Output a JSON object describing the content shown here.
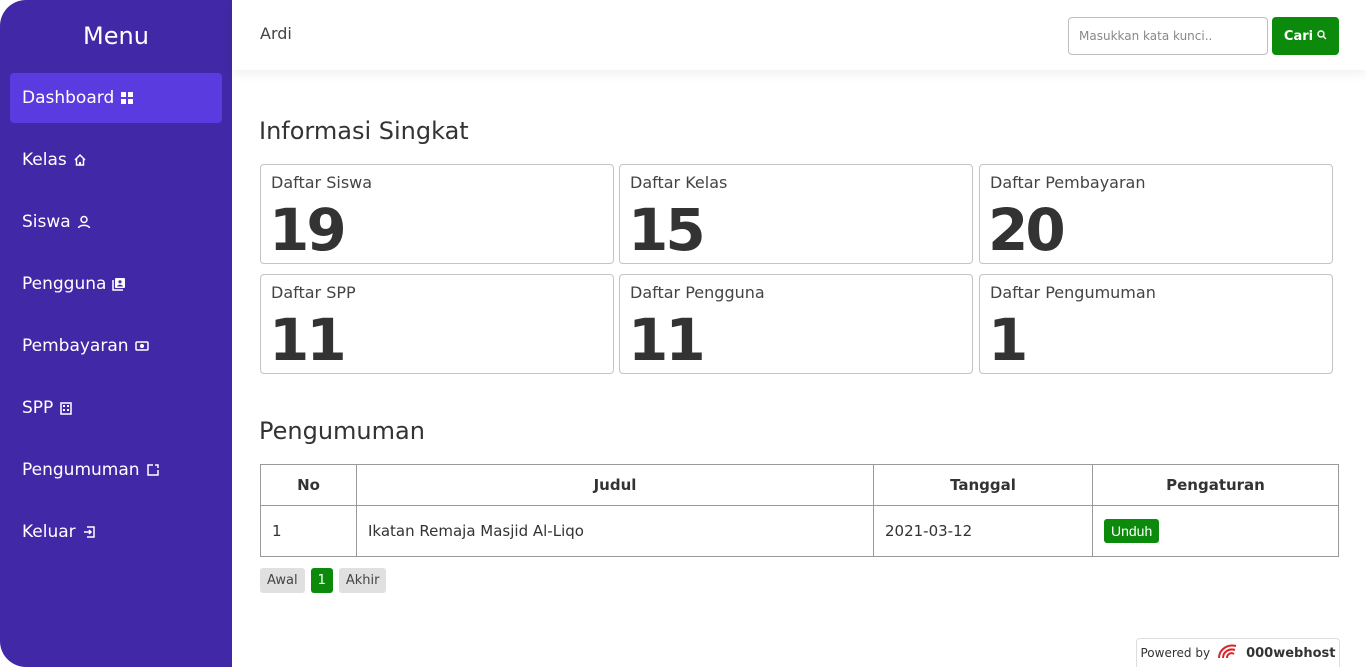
{
  "sidebar": {
    "title": "Menu",
    "items": [
      {
        "label": "Dashboard",
        "icon": "grid-icon"
      },
      {
        "label": "Kelas",
        "icon": "home-icon"
      },
      {
        "label": "Siswa",
        "icon": "user-icon"
      },
      {
        "label": "Pengguna",
        "icon": "contact-card-icon"
      },
      {
        "label": "Pembayaran",
        "icon": "money-icon"
      },
      {
        "label": "SPP",
        "icon": "building-icon"
      },
      {
        "label": "Pengumuman",
        "icon": "external-link-icon"
      },
      {
        "label": "Keluar",
        "icon": "logout-icon"
      }
    ]
  },
  "header": {
    "user": "Ardi",
    "search_placeholder": "Masukkan kata kunci..",
    "search_button": "Cari"
  },
  "info": {
    "title": "Informasi Singkat",
    "cards": [
      {
        "label": "Daftar Siswa",
        "value": "19"
      },
      {
        "label": "Daftar Kelas",
        "value": "15"
      },
      {
        "label": "Daftar Pembayaran",
        "value": "20"
      },
      {
        "label": "Daftar SPP",
        "value": "11"
      },
      {
        "label": "Daftar Pengguna",
        "value": "11"
      },
      {
        "label": "Daftar Pengumuman",
        "value": "1"
      }
    ]
  },
  "announcements": {
    "title": "Pengumuman",
    "columns": [
      "No",
      "Judul",
      "Tanggal",
      "Pengaturan"
    ],
    "rows": [
      {
        "no": "1",
        "judul": "Ikatan Remaja Masjid Al-Liqo",
        "tanggal": "2021-03-12",
        "action": "Unduh"
      }
    ]
  },
  "pagination": {
    "first": "Awal",
    "current": "1",
    "last": "Akhir"
  },
  "footer": {
    "powered_by": "Powered by",
    "brand": "000webhost"
  },
  "colors": {
    "sidebar": "#4128a6",
    "active_item": "#5a3be0",
    "accent_green": "#0b8a0b"
  }
}
